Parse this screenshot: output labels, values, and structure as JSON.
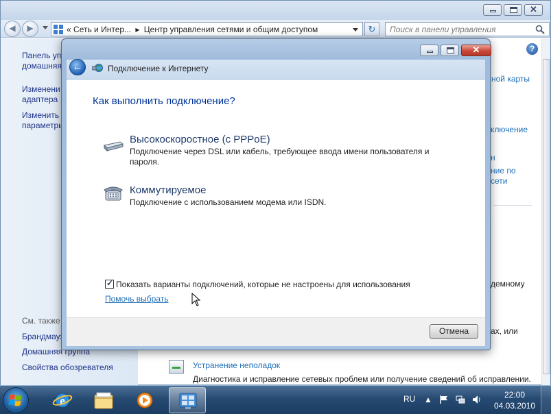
{
  "explorer": {
    "address": {
      "prefix": "«",
      "crumb_1": "Сеть и Интер...",
      "separator": "▸",
      "crumb_2": "Центр управления сетями и общим доступом"
    },
    "search_placeholder": "Поиск в панели управления",
    "left_pane": {
      "links": [
        [
          "Панель уп",
          "домашняя"
        ],
        [
          "Изменени",
          "адаптера"
        ],
        [
          "Изменить",
          "параметры"
        ]
      ],
      "see_also_label": "См. также",
      "see_also_links": [
        "Брандмауэ",
        "Домашняя группа",
        "Свойства обозревателя"
      ]
    },
    "main_fragments": {
      "map_link": "ной карты",
      "connect_link": "ключение",
      "fragment_n": "н",
      "share_link_1": "ние по",
      "share_link_2": "сети",
      "modem_text": "демному",
      "or_text": "ах, или"
    },
    "troubleshoot": {
      "title": "Устранение неполадок",
      "desc": "Диагностика и исправление сетевых проблем или получение сведений об исправлении."
    }
  },
  "dialog": {
    "title": "Подключение к Интернету",
    "question": "Как выполнить подключение?",
    "options": [
      {
        "title": "Высокоскоростное (с PPPoE)",
        "desc": "Подключение через DSL или кабель, требующее ввода имени пользователя и пароля.",
        "icon": "modem-icon"
      },
      {
        "title": "Коммутируемое",
        "desc": "Подключение с использованием модема или ISDN.",
        "icon": "dialup-phone-icon"
      }
    ],
    "show_all_checkbox_label": "Показать варианты подключений, которые не настроены для использования",
    "show_all_checked": true,
    "help_link": "Помочь выбрать",
    "cancel_label": "Отмена"
  },
  "taskbar": {
    "pinned": [
      "internet-explorer-icon",
      "file-explorer-icon",
      "media-player-icon",
      "control-panel-icon"
    ],
    "active_item": "control-panel-icon",
    "language": "RU",
    "time": "22:00",
    "date": "04.03.2010"
  },
  "colors": {
    "link": "#1e6fb8",
    "heading": "#003399",
    "taskbar": "#264a72"
  }
}
